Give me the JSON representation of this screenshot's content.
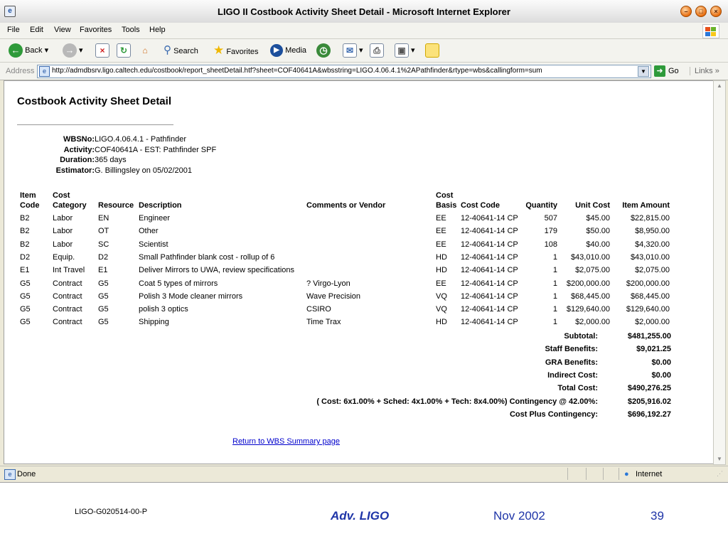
{
  "window": {
    "title": "LIGO II Costbook Activity Sheet Detail - Microsoft Internet Explorer"
  },
  "menu": [
    "File",
    "Edit",
    "View",
    "Favorites",
    "Tools",
    "Help"
  ],
  "toolbar": {
    "back": "Back",
    "search": "Search",
    "favorites": "Favorites",
    "media": "Media"
  },
  "address": {
    "label": "Address",
    "url": "http://admdbsrv.ligo.caltech.edu/costbook/report_sheetDetail.htf?sheet=COF40641A&wbsstring=LIGO.4.06.4.1%2APathfinder&rtype=wbs&callingform=sum",
    "go": "Go",
    "links": "Links"
  },
  "page": {
    "title": "Costbook Activity Sheet Detail",
    "info": [
      {
        "label": "WBSNo:",
        "value": "LIGO.4.06.4.1 - Pathfinder"
      },
      {
        "label": "Activity:",
        "value": "COF40641A - EST: Pathfinder SPF"
      },
      {
        "label": "Duration:",
        "value": "365 days"
      },
      {
        "label": "Estimator:",
        "value": "G. Billingsley on 05/02/2001"
      }
    ],
    "headers": {
      "item_code": "Item Code",
      "cost_category": "Cost Category",
      "resource": "Resource",
      "description": "Description",
      "comments": "Comments or Vendor",
      "cost_basis": "Cost Basis",
      "cost_code": "Cost Code",
      "quantity": "Quantity",
      "unit_cost": "Unit Cost",
      "item_amount": "Item Amount"
    },
    "rows": [
      {
        "item": "B2",
        "cat": "Labor",
        "res": "EN",
        "desc": "Engineer",
        "vendor": "",
        "basis": "EE",
        "code": "12-40641-14 CP",
        "qty": "507",
        "unit": "$45.00",
        "amount": "$22,815.00"
      },
      {
        "item": "B2",
        "cat": "Labor",
        "res": "OT",
        "desc": "Other",
        "vendor": "",
        "basis": "EE",
        "code": "12-40641-14 CP",
        "qty": "179",
        "unit": "$50.00",
        "amount": "$8,950.00"
      },
      {
        "item": "B2",
        "cat": "Labor",
        "res": "SC",
        "desc": "Scientist",
        "vendor": "",
        "basis": "EE",
        "code": "12-40641-14 CP",
        "qty": "108",
        "unit": "$40.00",
        "amount": "$4,320.00"
      },
      {
        "item": "D2",
        "cat": "Equip.",
        "res": "D2",
        "desc": "Small Pathfinder blank cost - rollup of 6",
        "vendor": "",
        "basis": "HD",
        "code": "12-40641-14 CP",
        "qty": "1",
        "unit": "$43,010.00",
        "amount": "$43,010.00"
      },
      {
        "item": "E1",
        "cat": "Int Travel",
        "res": "E1",
        "desc": "Deliver Mirrors to UWA, review specifications",
        "vendor": "",
        "basis": "HD",
        "code": "12-40641-14 CP",
        "qty": "1",
        "unit": "$2,075.00",
        "amount": "$2,075.00"
      },
      {
        "item": "G5",
        "cat": "Contract",
        "res": "G5",
        "desc": "Coat 5 types of mirrors",
        "vendor": "? Virgo-Lyon",
        "basis": "EE",
        "code": "12-40641-14 CP",
        "qty": "1",
        "unit": "$200,000.00",
        "amount": "$200,000.00"
      },
      {
        "item": "G5",
        "cat": "Contract",
        "res": "G5",
        "desc": "Polish 3 Mode cleaner mirrors",
        "vendor": "Wave Precision",
        "basis": "VQ",
        "code": "12-40641-14 CP",
        "qty": "1",
        "unit": "$68,445.00",
        "amount": "$68,445.00"
      },
      {
        "item": "G5",
        "cat": "Contract",
        "res": "G5",
        "desc": "polish 3 optics",
        "vendor": "CSIRO",
        "basis": "VQ",
        "code": "12-40641-14 CP",
        "qty": "1",
        "unit": "$129,640.00",
        "amount": "$129,640.00"
      },
      {
        "item": "G5",
        "cat": "Contract",
        "res": "G5",
        "desc": "Shipping",
        "vendor": "Time Trax",
        "basis": "HD",
        "code": "12-40641-14 CP",
        "qty": "1",
        "unit": "$2,000.00",
        "amount": "$2,000.00"
      }
    ],
    "summary": [
      {
        "label": "Subtotal:",
        "value": "$481,255.00"
      },
      {
        "label": "Staff Benefits:",
        "value": "$9,021.25"
      },
      {
        "label": "GRA Benefits:",
        "value": "$0.00"
      },
      {
        "label": "Indirect Cost:",
        "value": "$0.00"
      },
      {
        "label": "Total Cost:",
        "value": "$490,276.25"
      },
      {
        "label": "( Cost: 6x1.00% + Sched: 4x1.00% + Tech: 8x4.00%) Contingency @ 42.00%:",
        "value": "$205,916.02"
      },
      {
        "label": "Cost Plus Contingency:",
        "value": "$696,192.27"
      }
    ],
    "return_link": "Return to WBS Summary page"
  },
  "status": {
    "text": "Done",
    "zone": "Internet"
  },
  "footer": {
    "doc_id": "LIGO-G020514-00-P",
    "brand": "Adv. LIGO",
    "date": "Nov 2002",
    "page_num": "39",
    "brand_color": "#1f35a8"
  }
}
